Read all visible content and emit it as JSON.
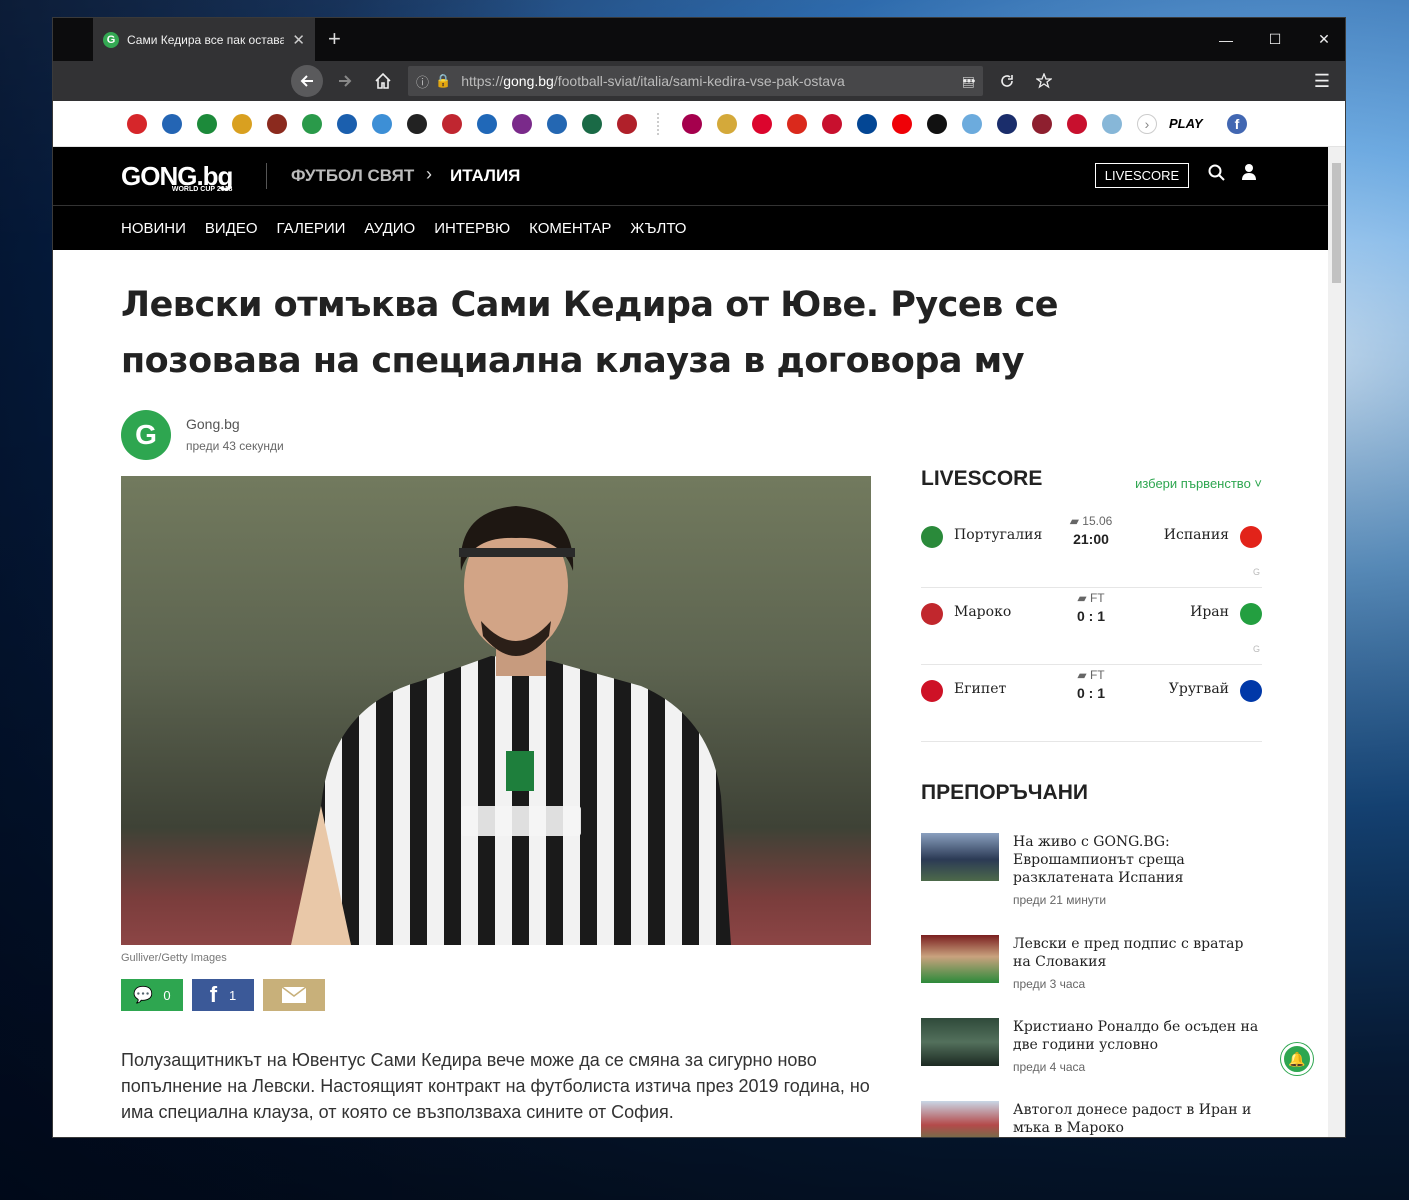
{
  "browser": {
    "tab_title": "Сами Кедира все пак остава",
    "tab_close": "✕",
    "new_tab": "+",
    "url_prefix": "https://",
    "url_host": "gong.bg",
    "url_path": "/football-sviat/italia/sami-kedira-vse-pak-ostava",
    "window_controls": [
      "—",
      "☐",
      "✕"
    ],
    "menu_icon": "☰",
    "more_icon": "•••"
  },
  "team_logos": {
    "left": [
      "#d6262a",
      "#2465b4",
      "#1c8a3a",
      "#d9a020",
      "#8b2a1e",
      "#2a9a4a",
      "#1b5fae",
      "#3d8fd6",
      "#222222",
      "#c02630",
      "#2068b8",
      "#7a2a8a",
      "#2467b2",
      "#1a6a46",
      "#b0202a"
    ],
    "right": [
      "#a5004d",
      "#d4a93a",
      "#dc052d",
      "#da291c",
      "#c8102e",
      "#034694",
      "#ef0107",
      "#111111",
      "#6cabdd",
      "#1a2d6b",
      "#8e1f2f",
      "#c8102e",
      "#87b7d8"
    ],
    "more_label": "›",
    "play_label": "PLAY",
    "facebook_label": "f"
  },
  "site": {
    "brand": "GONG.bg",
    "brand_sub": "WORLD CUP 2018",
    "breadcrumb_1": "ФУТБОЛ СВЯТ",
    "breadcrumb_sep": "›",
    "breadcrumb_2": "ИТАЛИЯ",
    "livescore_button": "LIVESCORE",
    "menu": [
      "НОВИНИ",
      "ВИДЕО",
      "ГАЛЕРИИ",
      "АУДИО",
      "ИНТЕРВЮ",
      "КОМЕНТАР",
      "ЖЪЛТО"
    ]
  },
  "article": {
    "title": "Левски отмъква Сами Кедира от Юве. Русев се позовава на специална клауза в договора му",
    "author_initial": "G",
    "author": "Gong.bg",
    "time": "преди 43 секунди",
    "photo_caption": "Gulliver/Getty Images",
    "shares": {
      "comments": "0",
      "facebook": "1"
    },
    "body": "Полузащитникът на Ювентус Сами Кедира вече може да се смяна за сигурно ново попълнение на Левски. Настоящият контракт на футболиста изтича през 2019 година, но има специална клауза, от която се възползваха сините от София."
  },
  "livescore": {
    "heading": "LIVESCORE",
    "pick": "избери първенство ˅",
    "matches": [
      {
        "home": "Португалия",
        "away": "Испания",
        "status": "15.06",
        "score": "21:00",
        "home_color": "#2a8a3a",
        "away_color": "#e2231a"
      },
      {
        "home": "Мароко",
        "away": "Иран",
        "status": "FT",
        "score": "0 : 1",
        "home_color": "#c1272d",
        "away_color": "#239f40"
      },
      {
        "home": "Египет",
        "away": "Уругвай",
        "status": "FT",
        "score": "0 : 1",
        "home_color": "#ce1126",
        "away_color": "#0038a8"
      }
    ]
  },
  "recommended": {
    "heading": "ПРЕПОРЪЧАНИ",
    "items": [
      {
        "title": "На живо с GONG.BG: Еврошампионът среща разклатената Испания",
        "time": "преди 21 минути"
      },
      {
        "title": "Левски е пред подпис с вратар на Словакия",
        "time": "преди 3 часа"
      },
      {
        "title": "Кристиано Роналдо бе осъден на две години условно",
        "time": "преди 4 часа"
      },
      {
        "title": "Автогол донесе радост в Иран и мъка в Мароко",
        "time": ""
      }
    ]
  },
  "notification_icon": "🔔"
}
